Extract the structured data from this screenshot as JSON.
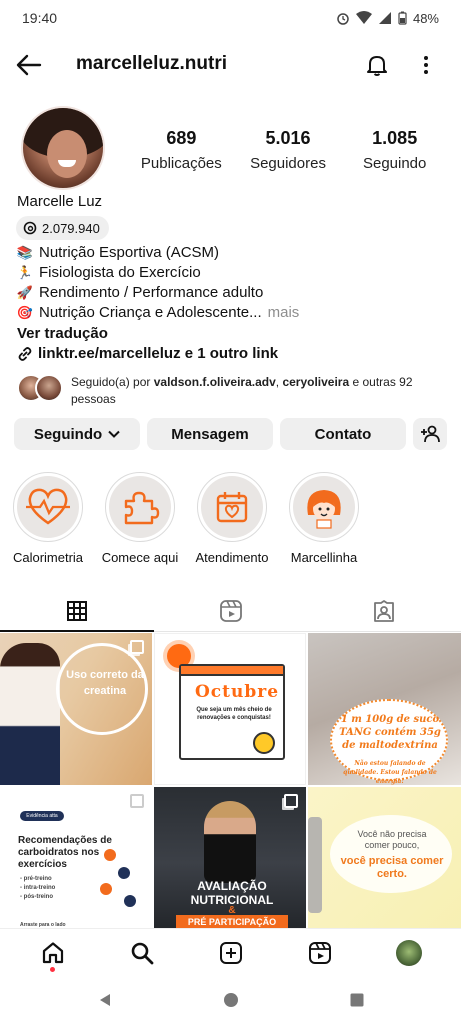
{
  "status_bar": {
    "time": "19:40",
    "battery": "48%"
  },
  "header": {
    "username": "marcelleluz.nutri"
  },
  "profile": {
    "stats": [
      {
        "value": "689",
        "label": "Publicações"
      },
      {
        "value": "5.016",
        "label": "Seguidores"
      },
      {
        "value": "1.085",
        "label": "Seguindo"
      }
    ],
    "full_name": "Marcelle Luz",
    "threads_count": "2.079.940",
    "bio": [
      {
        "emoji": "📚",
        "text": "Nutrição Esportiva (ACSM)"
      },
      {
        "emoji": "🏃",
        "text": "Fisiologista do Exercício"
      },
      {
        "emoji": "🚀",
        "text": "Rendimento / Performance adulto"
      },
      {
        "emoji": "🎯",
        "text": "Nutrição Criança e Adolescente..."
      }
    ],
    "more_label": "mais",
    "translate_label": "Ver tradução",
    "link_text": "linktr.ee/marcelleluz e 1 outro link",
    "followed_by": {
      "prefix": "Seguido(a) por ",
      "user1": "valdson.f.oliveira.adv",
      "sep": ", ",
      "user2": "ceryoliveira",
      "suffix": " e outras 92 pessoas"
    }
  },
  "actions": {
    "following_label": "Seguindo",
    "message_label": "Mensagem",
    "contact_label": "Contato"
  },
  "highlights": [
    {
      "label": "Calorimetria",
      "icon": "heart-pulse-icon"
    },
    {
      "label": "Comece aqui",
      "icon": "puzzle-icon"
    },
    {
      "label": "Atendimento",
      "icon": "calendar-heart-icon"
    },
    {
      "label": "Marcellinha",
      "icon": "cartoon-girl-icon"
    }
  ],
  "tabs": [
    {
      "name": "grid-tab",
      "icon": "grid-icon",
      "active": true
    },
    {
      "name": "reels-tab",
      "icon": "reels-icon",
      "active": false
    },
    {
      "name": "tagged-tab",
      "icon": "tagged-user-icon",
      "active": false
    }
  ],
  "posts": {
    "p1": {
      "text": "Uso correto da creatina"
    },
    "p2": {
      "title": "Octubre",
      "subtitle": "Que seja um mês cheio de renovações e conquistas!"
    },
    "p3": {
      "text": "1 m 100g de suco TANG contém 35g de maltodextrina",
      "small": "Não estou falando de qualidade. Estou falando de energia!"
    },
    "p4": {
      "badge": "Evidência atta",
      "title": "Recomendações de carboidratos nos exercícios",
      "list": "- pré-treino\n- intra-treino\n- pós-treino",
      "footer": "Arraste para o lado"
    },
    "p5": {
      "line1": "AVALIAÇÃO NUTRICIONAL",
      "amp": "&",
      "line2": "PRÉ PARTICIPAÇÃO"
    },
    "p6": {
      "line1": "Você não precisa comer pouco,",
      "line2": "você precisa comer certo."
    }
  },
  "colors": {
    "accent": "#f26b1d",
    "text": "#111111",
    "button_bg": "#efefef",
    "notification_dot": "#ff3040"
  }
}
